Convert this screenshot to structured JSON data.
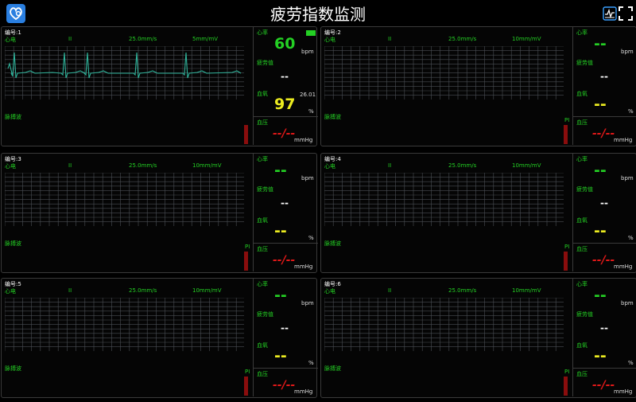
{
  "header": {
    "title": "疲劳指数监测"
  },
  "colors": {
    "hr": "#24d024",
    "spo2": "#ecec20",
    "bp": "#e01818",
    "grid": "#4a4f55",
    "ecg": "#2fb39a"
  },
  "panels": [
    {
      "id_label": "编号:1",
      "ecg_label": "心电",
      "lead": "II",
      "speed": "25.0mm/s",
      "gain": "5mm/mV",
      "pulse_label": "脉搏波",
      "pi_label": "",
      "hr_label": "心率",
      "hr_value": "60",
      "hr_unit": "bpm",
      "fatigue_label": "疲劳值",
      "fatigue_value": "--",
      "spo2_label": "血氧",
      "spo2_value": "97",
      "spo2_extra": "26.01",
      "spo2_unit": "%",
      "bp_label": "血压",
      "bp_value": "--/--",
      "bp_unit": "mmHg"
    },
    {
      "id_label": "编号:2",
      "ecg_label": "心电",
      "lead": "II",
      "speed": "25.0mm/s",
      "gain": "10mm/mV",
      "pulse_label": "脉搏波",
      "pi_label": "PI",
      "hr_label": "心率",
      "hr_value": "--",
      "hr_unit": "bpm",
      "fatigue_label": "疲劳值",
      "fatigue_value": "--",
      "spo2_label": "血氧",
      "spo2_value": "--",
      "spo2_extra": "",
      "spo2_unit": "%",
      "bp_label": "血压",
      "bp_value": "--/--",
      "bp_unit": "mmHg"
    },
    {
      "id_label": "编号:3",
      "ecg_label": "心电",
      "lead": "II",
      "speed": "25.0mm/s",
      "gain": "10mm/mV",
      "pulse_label": "脉搏波",
      "pi_label": "PI",
      "hr_label": "心率",
      "hr_value": "--",
      "hr_unit": "bpm",
      "fatigue_label": "疲劳值",
      "fatigue_value": "--",
      "spo2_label": "血氧",
      "spo2_value": "--",
      "spo2_extra": "",
      "spo2_unit": "%",
      "bp_label": "血压",
      "bp_value": "--/--",
      "bp_unit": "mmHg"
    },
    {
      "id_label": "编号:4",
      "ecg_label": "心电",
      "lead": "II",
      "speed": "25.0mm/s",
      "gain": "10mm/mV",
      "pulse_label": "脉搏波",
      "pi_label": "PI",
      "hr_label": "心率",
      "hr_value": "--",
      "hr_unit": "bpm",
      "fatigue_label": "疲劳值",
      "fatigue_value": "--",
      "spo2_label": "血氧",
      "spo2_value": "--",
      "spo2_extra": "",
      "spo2_unit": "%",
      "bp_label": "血压",
      "bp_value": "--/--",
      "bp_unit": "mmHg"
    },
    {
      "id_label": "编号:5",
      "ecg_label": "心电",
      "lead": "II",
      "speed": "25.0mm/s",
      "gain": "10mm/mV",
      "pulse_label": "脉搏波",
      "pi_label": "PI",
      "hr_label": "心率",
      "hr_value": "--",
      "hr_unit": "bpm",
      "fatigue_label": "疲劳值",
      "fatigue_value": "--",
      "spo2_label": "血氧",
      "spo2_value": "--",
      "spo2_extra": "",
      "spo2_unit": "%",
      "bp_label": "血压",
      "bp_value": "--/--",
      "bp_unit": "mmHg"
    },
    {
      "id_label": "编号:6",
      "ecg_label": "心电",
      "lead": "II",
      "speed": "25.0mm/s",
      "gain": "10mm/mV",
      "pulse_label": "脉搏波",
      "pi_label": "PI",
      "hr_label": "心率",
      "hr_value": "--",
      "hr_unit": "bpm",
      "fatigue_label": "疲劳值",
      "fatigue_value": "--",
      "spo2_label": "血氧",
      "spo2_value": "--",
      "spo2_extra": "",
      "spo2_unit": "%",
      "bp_label": "血压",
      "bp_value": "--/--",
      "bp_unit": "mmHg"
    }
  ]
}
